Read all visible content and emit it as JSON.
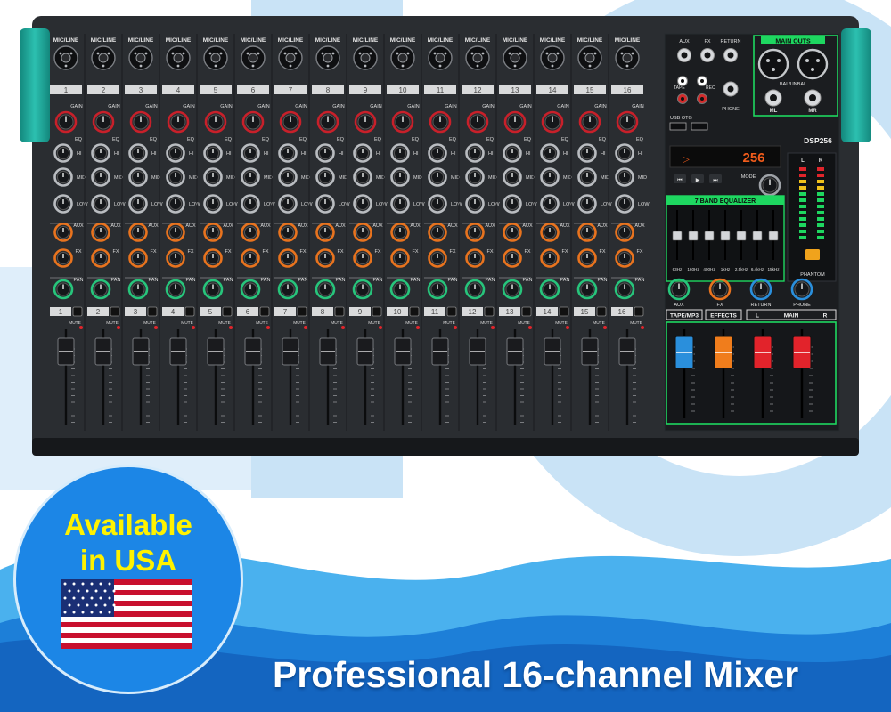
{
  "caption": "Professional 16-channel Mixer",
  "badge": {
    "line1": "Available",
    "line2": "in USA"
  },
  "mixer": {
    "channel_count": 16,
    "input_label": "MIC/LINE",
    "knob_labels": {
      "gain": "GAIN",
      "eq": "EQ",
      "hi": "HI",
      "mid": "MID",
      "low": "LOW",
      "aux": "AUX",
      "fx": "FX",
      "pan": "PAN",
      "mute": "MUTE",
      "pk": "PK"
    },
    "master": {
      "jacks": [
        "AUX",
        "FX",
        "RETURN"
      ],
      "main_outs": "MAIN OUTS",
      "tape": "TAPE",
      "rec": "REC",
      "phone": "PHONE",
      "bal_unbal": "BAL/UNBAL",
      "ml": "ML",
      "mr": "MR",
      "usb_otg": "USB OTG",
      "dsp": "DSP256",
      "display": "256",
      "mode": "MODE",
      "eq_title": "7 BAND EQUALIZER",
      "eq_freqs": [
        "63Hz",
        "160Hz",
        "400Hz",
        "1kHz",
        "2.5kHz",
        "6.4kHz",
        "15kHz"
      ],
      "phantom": "PHANTOM",
      "knobs": [
        "AUX",
        "FX",
        "RETURN",
        "PHONE"
      ],
      "fader_labels": [
        "TAPE/MP3",
        "EFFECTS"
      ],
      "main": "MAIN",
      "main_l": "L",
      "main_r": "R",
      "meter_l": "L",
      "meter_r": "R"
    }
  },
  "colors": {
    "panel": "#2a2d31",
    "side_cap": "#1fa89a",
    "accent_green": "#1ed760",
    "knob_red": "#c8202a",
    "knob_orange": "#e8731e",
    "knob_green": "#27c47b",
    "fader_blue": "#2a8fdc",
    "fader_orange": "#f07d1c",
    "fader_red": "#e2232b",
    "badge_blue": "#1c86e6",
    "badge_text": "#fff200"
  }
}
